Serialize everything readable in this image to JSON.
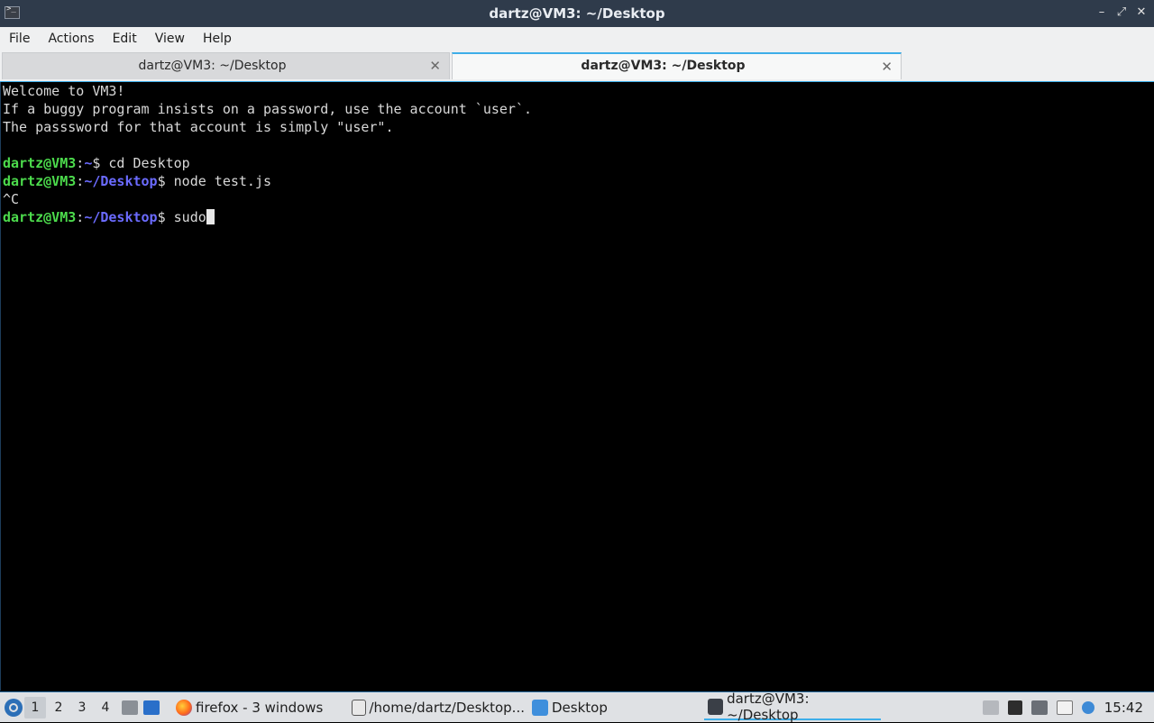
{
  "window": {
    "title": "dartz@VM3: ~/Desktop",
    "controls": [
      "–",
      "⤢",
      "✕"
    ]
  },
  "menu": [
    "File",
    "Actions",
    "Edit",
    "View",
    "Help"
  ],
  "tabs": [
    {
      "label": "dartz@VM3: ~/Desktop",
      "active": false
    },
    {
      "label": "dartz@VM3: ~/Desktop",
      "active": true
    }
  ],
  "tab_close_glyph": "✕",
  "terminal": {
    "welcome": [
      "Welcome to VM3!",
      "If a buggy program insists on a password, use the account `user`.",
      "The passsword for that account is simply \"user\"."
    ],
    "prompt_user": "dartz@VM3",
    "sep": ":",
    "home_path": "~",
    "desktop_path": "~/Desktop",
    "dollar": "$",
    "cmd1": " cd Desktop",
    "cmd2": " node test.js",
    "interrupt": "^C",
    "cmd3": " sudo"
  },
  "taskbar": {
    "workspaces": [
      "1",
      "2",
      "3",
      "4"
    ],
    "active_workspace": "1",
    "tasks": [
      {
        "label": "firefox - 3 windows",
        "icon": "firefox-icon"
      },
      {
        "label": "/home/dartz/Desktop...",
        "icon": "text-editor-icon"
      },
      {
        "label": "Desktop",
        "icon": "folder-icon"
      },
      {
        "label": "dartz@VM3: ~/Desktop",
        "icon": "terminal-icon"
      }
    ],
    "clock": "15:42"
  },
  "colors": {
    "accent": "#3daee9",
    "prompt_user": "#4cdb4c",
    "prompt_path": "#6b6bff"
  }
}
